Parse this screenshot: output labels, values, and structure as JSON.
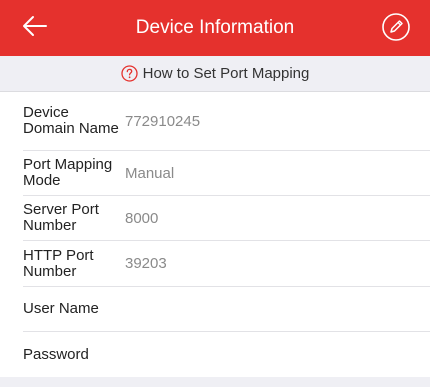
{
  "header": {
    "title": "Device Information",
    "back_icon": "arrow-left-icon",
    "edit_icon": "pencil-circle-icon",
    "bg_color": "#e5312d"
  },
  "help": {
    "text": "How to Set Port Mapping",
    "icon": "question-circle-icon",
    "icon_color": "#e5312d"
  },
  "fields": [
    {
      "label": "Device Domain Name",
      "value": "772910245"
    },
    {
      "label": "Port Mapping Mode",
      "value": "Manual"
    },
    {
      "label": "Server Port Number",
      "value": "8000"
    },
    {
      "label": "HTTP Port Number",
      "value": "39203"
    },
    {
      "label": "User Name",
      "value": ""
    },
    {
      "label": "Password",
      "value": ""
    }
  ]
}
